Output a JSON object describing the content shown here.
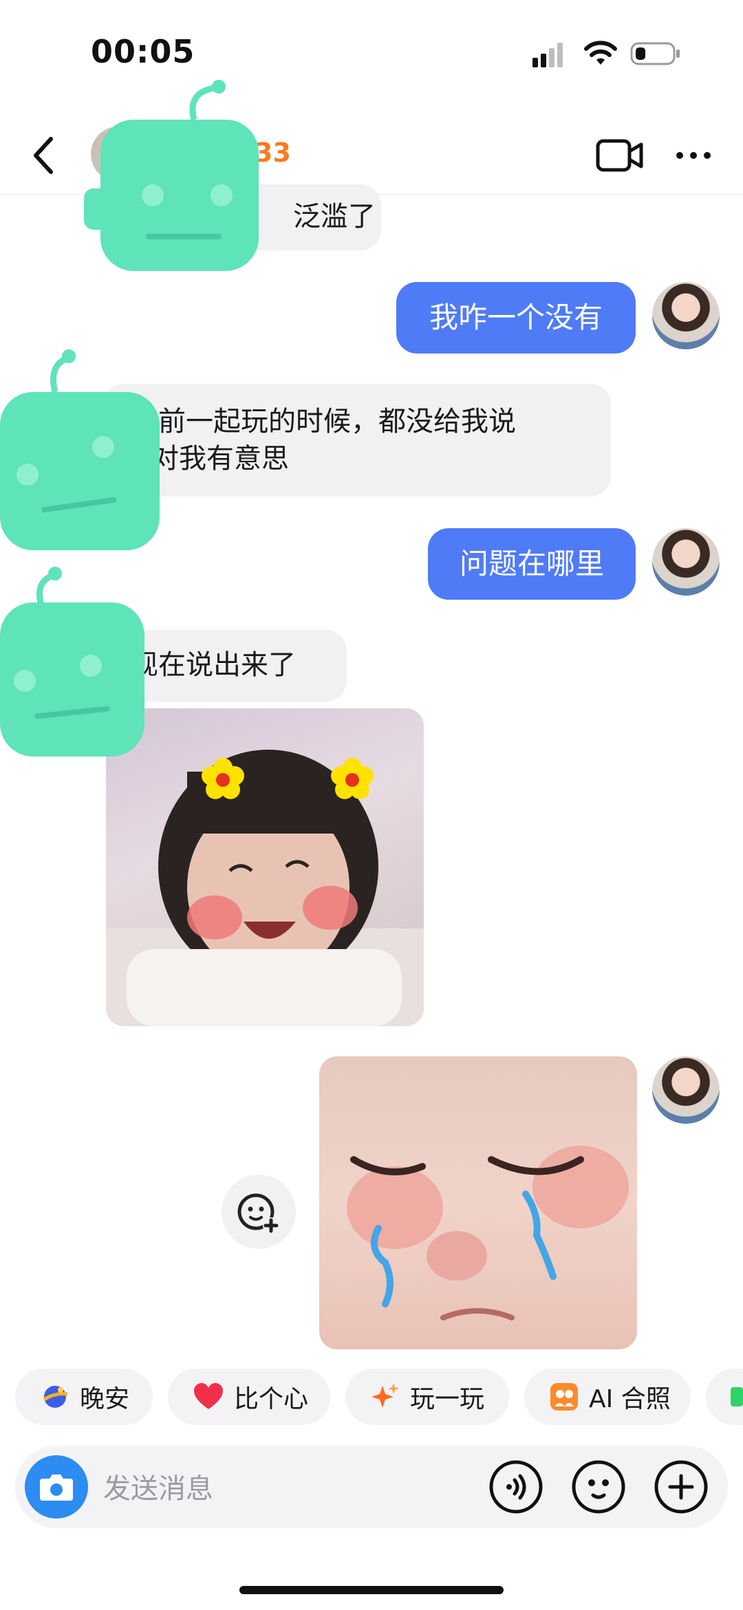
{
  "status_bar": {
    "time": "00:05"
  },
  "header": {
    "contact_name": "33"
  },
  "messages": [
    {
      "side": "in",
      "text": "泛滥了"
    },
    {
      "side": "out",
      "text": "我咋一个没有"
    },
    {
      "side": "in",
      "text_line1": "以前一起玩的时候，都没给我说",
      "text_line2": "对我有意思"
    },
    {
      "side": "out",
      "text": "问题在哪里"
    },
    {
      "side": "in",
      "text": "现在说出来了"
    },
    {
      "side": "in",
      "type": "sticker",
      "sticker": "smiling-girl-flowers"
    },
    {
      "side": "out",
      "type": "sticker",
      "sticker": "crying-baby"
    }
  ],
  "quick_chips": [
    {
      "label": "晚安",
      "icon": "moon-planet-icon"
    },
    {
      "label": "比个心",
      "icon": "heart-icon"
    },
    {
      "label": "玩一玩",
      "icon": "sparkle-icon"
    },
    {
      "label": "AI 合照",
      "icon": "ai-photo-icon"
    }
  ],
  "input": {
    "placeholder": "发送消息"
  },
  "colors": {
    "outgoing_bubble": "#4f7bf7",
    "incoming_bubble": "#f1f1f4",
    "accent_orange": "#ff7a22",
    "camera_blue": "#2c8cf2"
  }
}
